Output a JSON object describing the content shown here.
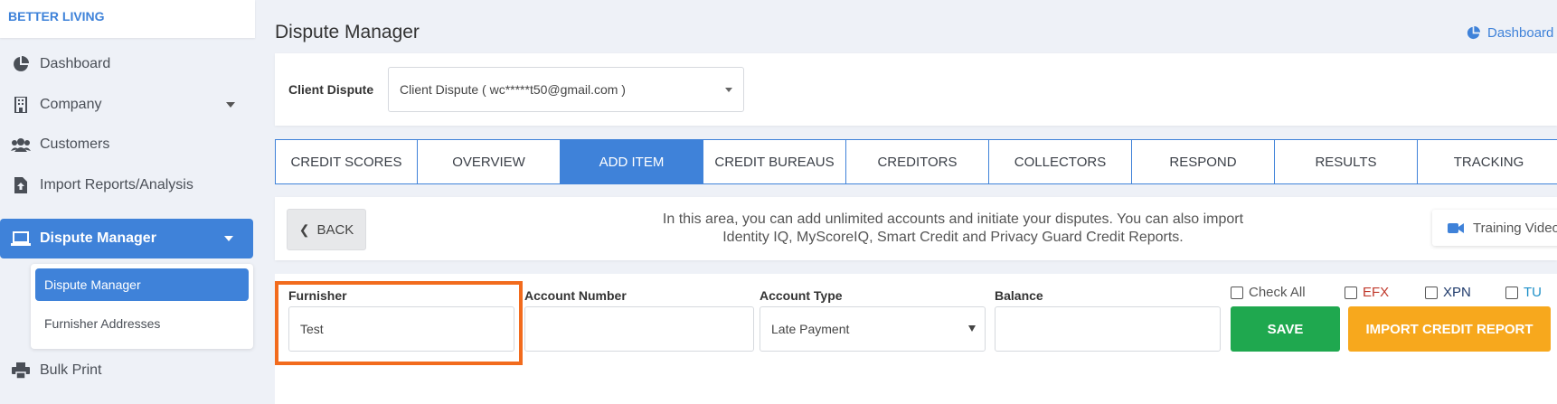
{
  "brand": "BETTER LIVING",
  "sidebar": {
    "items": [
      {
        "label": "Dashboard",
        "icon": "pie-chart-icon"
      },
      {
        "label": "Company",
        "icon": "building-icon"
      },
      {
        "label": "Customers",
        "icon": "users-icon"
      },
      {
        "label": "Import Reports/Analysis",
        "icon": "file-upload-icon"
      },
      {
        "label": "Dispute Manager",
        "icon": "laptop-icon"
      },
      {
        "label": "Bulk Print",
        "icon": "printer-icon"
      }
    ],
    "submenu": [
      {
        "label": "Dispute Manager"
      },
      {
        "label": "Furnisher Addresses"
      }
    ]
  },
  "header": {
    "title": "Dispute Manager",
    "dashboard_link": "Dashboard"
  },
  "client": {
    "label": "Client Dispute",
    "selected": "Client Dispute ( wc*****t50@gmail.com )"
  },
  "tabs": [
    {
      "label": "CREDIT SCORES"
    },
    {
      "label": "OVERVIEW"
    },
    {
      "label": "ADD ITEM"
    },
    {
      "label": "CREDIT BUREAUS"
    },
    {
      "label": "CREDITORS"
    },
    {
      "label": "COLLECTORS"
    },
    {
      "label": "RESPOND"
    },
    {
      "label": "RESULTS"
    },
    {
      "label": "TRACKING"
    }
  ],
  "info": {
    "back_label": "BACK",
    "text": "In this area, you can add unlimited accounts and initiate your disputes. You can also import Identity IQ, MyScoreIQ, Smart Credit and Privacy Guard Credit Reports.",
    "training_label": "Training Video"
  },
  "form": {
    "furnisher_label": "Furnisher",
    "furnisher_value": "Test",
    "account_number_label": "Account Number",
    "account_number_value": "",
    "account_type_label": "Account Type",
    "account_type_value": "Late Payment",
    "balance_label": "Balance",
    "balance_value": "",
    "check_all_label": "Check All",
    "efx_label": "EFX",
    "xpn_label": "XPN",
    "tu_label": "TU",
    "save_label": "SAVE",
    "import_label": "IMPORT CREDIT REPORT"
  },
  "colors": {
    "accent": "#3f82d9",
    "save": "#1fa84f",
    "import": "#f7a81d",
    "highlight": "#f26b1d",
    "efx": "#c0392b",
    "xpn": "#1f3a6b",
    "tu": "#1e90c8"
  }
}
